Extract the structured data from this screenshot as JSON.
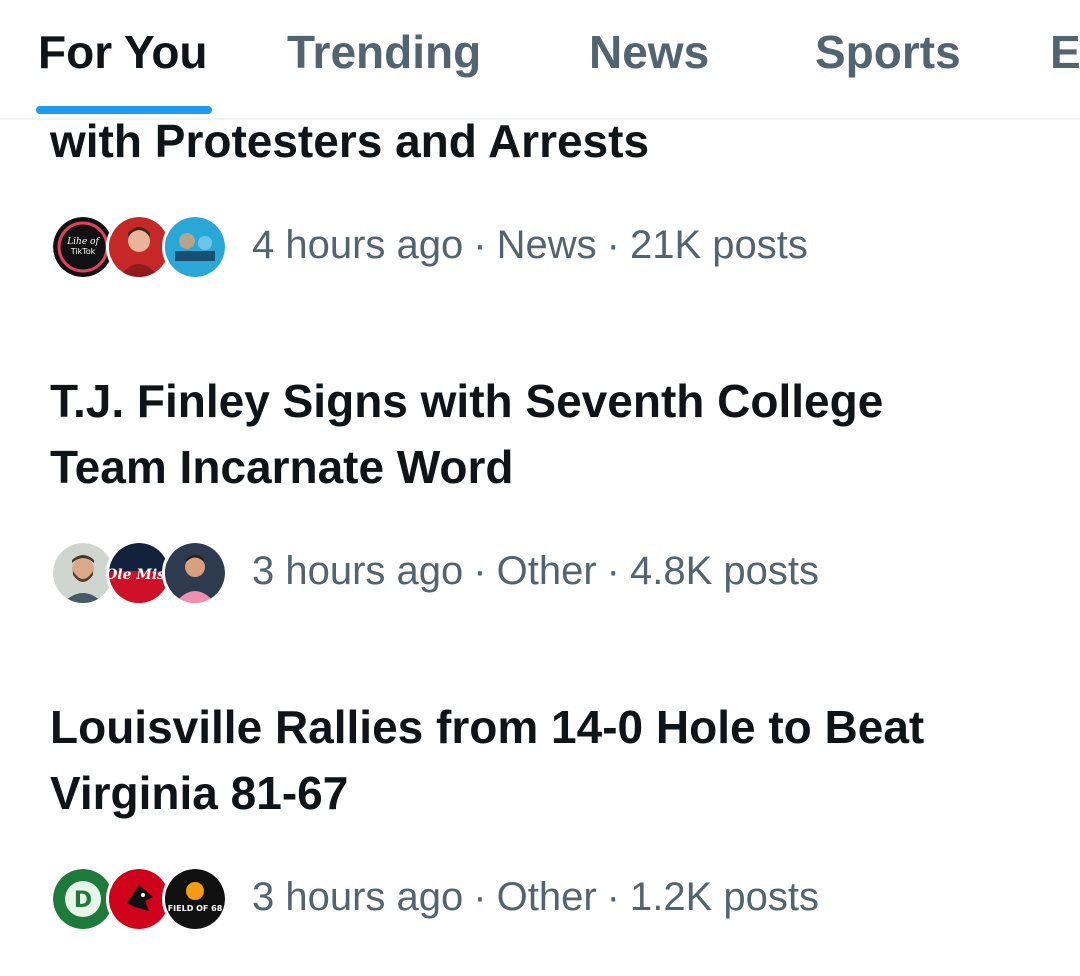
{
  "tabs": [
    {
      "label": "For You",
      "active": true
    },
    {
      "label": "Trending",
      "active": false
    },
    {
      "label": "News",
      "active": false
    },
    {
      "label": "Sports",
      "active": false
    },
    {
      "label": "E",
      "active": false
    }
  ],
  "colors": {
    "accent": "#1d9bf0",
    "text_primary": "#0f1419",
    "text_secondary": "#536471"
  },
  "trends": [
    {
      "title_lines": [
        "with Protesters and Arrests"
      ],
      "avatars": [
        "lihe-of-tiktok-avatar",
        "man-red-jacket-avatar",
        "blue-logo-avatar"
      ],
      "time": "4 hours ago",
      "category": "News",
      "posts": "21K posts"
    },
    {
      "title_lines": [
        "T.J. Finley Signs with Seventh College",
        "Team Incarnate Word"
      ],
      "avatars": [
        "bearded-man-avatar",
        "ole-miss-logo-avatar",
        "man-pink-shirt-avatar"
      ],
      "time": "3 hours ago",
      "category": "Other",
      "posts": "4.8K posts"
    },
    {
      "title_lines": [
        "Louisville Rallies from 14-0 Hole to Beat",
        "Virginia 81-67"
      ],
      "avatars": [
        "green-d-logo-avatar",
        "cardinal-logo-avatar",
        "field-of-68-logo-avatar"
      ],
      "time": "3 hours ago",
      "category": "Other",
      "posts": "1.2K posts"
    }
  ],
  "meta_separator": "·",
  "avatar_texts": {
    "lihe_line1": "Lihe of",
    "lihe_line2": "TikTok",
    "ole_miss": "Ole Miss",
    "field_of_68": "FIELD OF 68",
    "d_letter": "D"
  }
}
